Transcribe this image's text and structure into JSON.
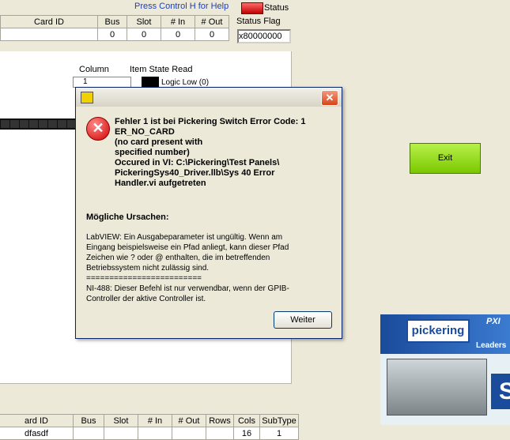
{
  "help_text": "Press Control H for Help",
  "status": {
    "label": "Status",
    "flag_label": "Status Flag",
    "flag_value": "x80000000"
  },
  "top_table": {
    "headers": [
      "Card ID",
      "Bus",
      "Slot",
      "# In",
      "# Out"
    ],
    "row": [
      "",
      "0",
      "0",
      "0",
      "0"
    ]
  },
  "panel": {
    "column_label": "Column",
    "item_state_label": "Item State Read",
    "column_value": "1",
    "state_text": "Logic Low (0)"
  },
  "exit_label": "Exit",
  "dialog": {
    "close_glyph": "✕",
    "error_text": "Fehler 1 ist bei Pickering Switch Error Code: 1\nER_NO_CARD\n(no card present with\n specified number)\n Occured in VI: C:\\Pickering\\Test Panels\\\nPickeringSys40_Driver.llb\\Sys 40 Error\nHandler.vi aufgetreten",
    "causes_heading": "Mögliche Ursachen:",
    "causes_text": "LabVIEW:  Ein Ausgabeparameter ist ungültig.  Wenn am\nEingang beispielsweise ein Pfad anliegt, kann dieser Pfad\nZeichen wie ? oder @ enthalten, die im betreffenden\nBetriebssystem nicht zulässig sind.\n=========================\nNI-488:  Dieser Befehl ist nur verwendbar, wenn der GPIB-\nController der aktive Controller ist.",
    "button_label": "Weiter"
  },
  "logo": {
    "name": "pickering",
    "pxi": "PXI",
    "leader": "Leaders",
    "s": "S"
  },
  "bottom_table": {
    "headers": [
      "ard ID",
      "Bus",
      "Slot",
      "# In",
      "# Out",
      "Rows",
      "Cols",
      "SubType"
    ],
    "row": [
      "dfasdf",
      "",
      "",
      "",
      "",
      "",
      "16",
      "1"
    ]
  }
}
